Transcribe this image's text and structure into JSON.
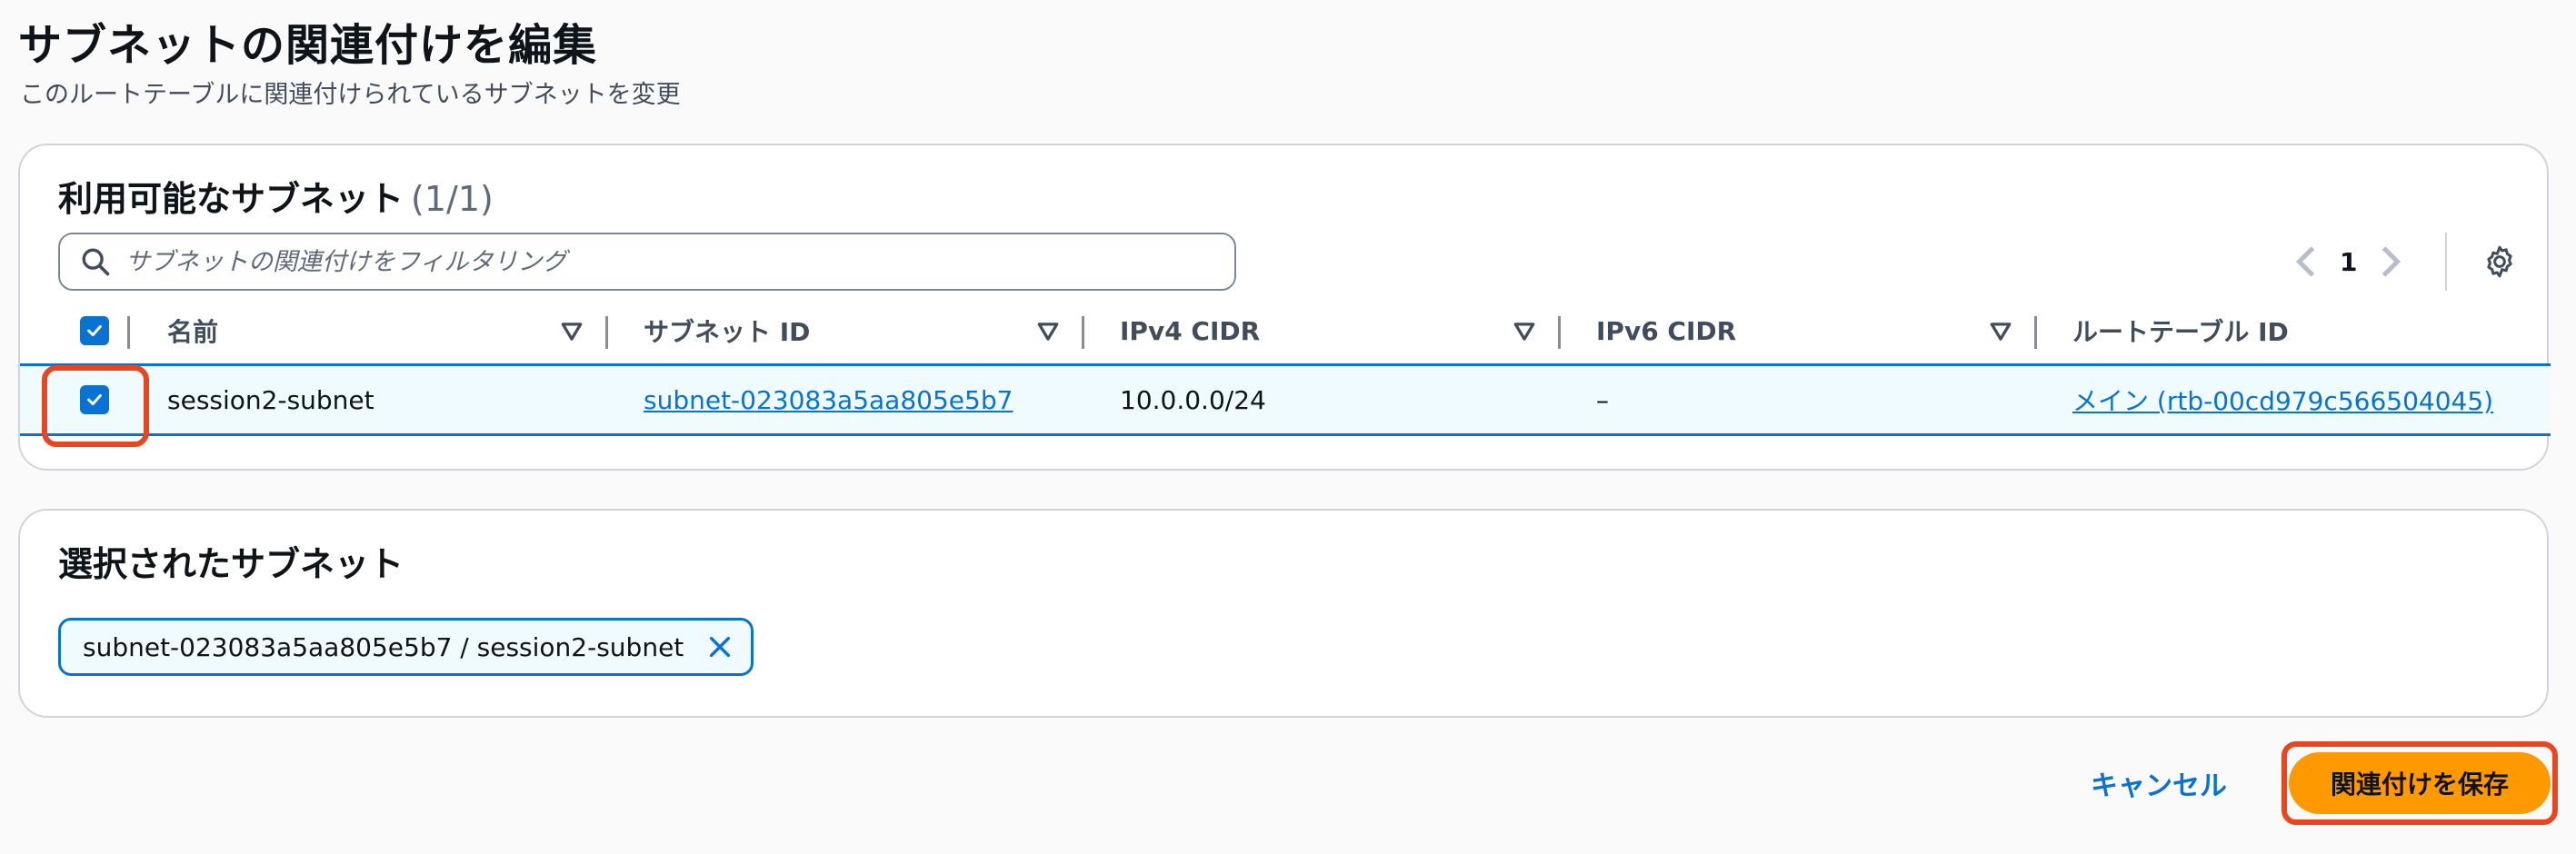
{
  "page": {
    "title": "サブネットの関連付けを編集",
    "description": "このルートテーブルに関連付けられているサブネットを変更"
  },
  "available": {
    "heading": "利用可能なサブネット",
    "count": "(1/1)",
    "filter_placeholder": "サブネットの関連付けをフィルタリング",
    "page_number": "1",
    "columns": [
      "名前",
      "サブネット ID",
      "IPv4 CIDR",
      "IPv6 CIDR",
      "ルートテーブル ID"
    ],
    "rows": [
      {
        "checked": true,
        "name": "session2-subnet",
        "subnet_id": "subnet-023083a5aa805e5b7",
        "ipv4_cidr": "10.0.0.0/24",
        "ipv6_cidr": "–",
        "route_table_id": "メイン (rtb-00cd979c566504045)"
      }
    ]
  },
  "selected": {
    "heading": "選択されたサブネット",
    "token_label": "subnet-023083a5aa805e5b7 / session2-subnet"
  },
  "actions": {
    "cancel_label": "キャンセル",
    "save_label": "関連付けを保存"
  },
  "colors": {
    "accent": "#0972d3",
    "primary_button": "#ff9900",
    "highlight": "#e8461e"
  }
}
